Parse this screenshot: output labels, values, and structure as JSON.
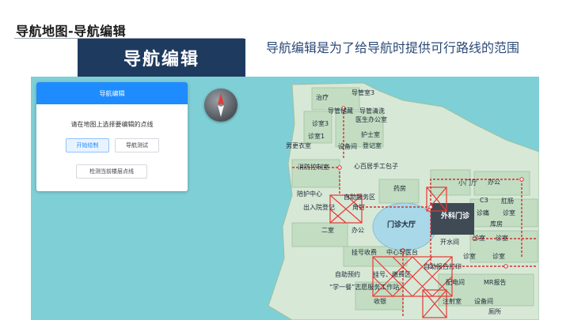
{
  "slide": {
    "title": "导航地图-导航编辑",
    "banner": "导航编辑",
    "description": "导航编辑是为了给导航时提供可行路线的范围"
  },
  "panel": {
    "header": "导航编辑",
    "hint": "请在地图上选择要编辑的点线",
    "start_button": "开始绘制",
    "test_button": "导航测试",
    "check_button": "检测当前楼层点线"
  },
  "compass": {
    "icon": "compass-icon"
  },
  "map": {
    "labels": [
      "导管室3",
      "治疗",
      "导管储藏",
      "导管清洗",
      "诊室3",
      "医生办公室",
      "诊室1",
      "护士室",
      "男更衣室",
      "设备间",
      "登记室",
      "消防控制室",
      "心百居手工包子",
      "药房",
      "小门厅",
      "办公",
      "陪护中心",
      "自助服务区",
      "出入院登记",
      "门诊大厅",
      "外科门诊",
      "C3",
      "肛肠",
      "肛肠",
      "诊痛",
      "诊室",
      "库房",
      "开水间",
      "诊室",
      "诊室",
      "诊室",
      "诊室",
      "挂号收费",
      "中心导医台",
      "自助预约",
      "挂号、缴费区",
      "自助报告打印",
      "配电间",
      "MR报告",
      "“学一餐”志愿服务工作站",
      "收银",
      "注射室",
      "设备间",
      "厕所",
      "办公",
      "二室",
      "角钉"
    ]
  },
  "colors": {
    "banner_bg": "#1f3a5f",
    "panel_header": "#1e8cff",
    "water": "#7fcfd6",
    "building": "#d7e8d6",
    "room": "#c3ddc2",
    "route": "#e53935",
    "hall": "#a9d8e8"
  }
}
